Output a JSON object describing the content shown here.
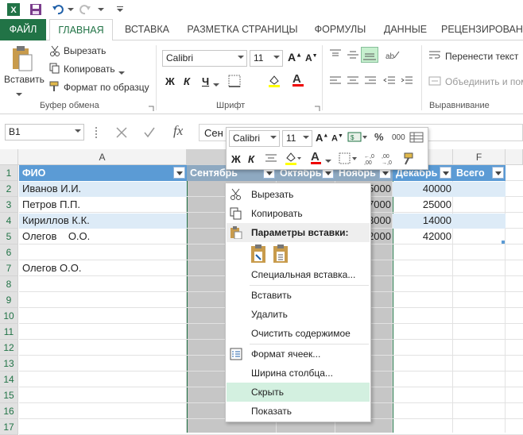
{
  "qat": {
    "icons": [
      "excel-icon",
      "save-icon",
      "undo-icon",
      "redo-icon",
      "customize-icon"
    ]
  },
  "tabs": [
    "ФАЙЛ",
    "ГЛАВНАЯ",
    "ВСТАВКА",
    "РАЗМЕТКА СТРАНИЦЫ",
    "ФОРМУЛЫ",
    "ДАННЫЕ",
    "РЕЦЕНЗИРОВАНИ"
  ],
  "clipboard": {
    "paste": "Вставить",
    "cut": "Вырезать",
    "copy": "Копировать",
    "format_painter": "Формат по образцу",
    "group": "Буфер обмена"
  },
  "font": {
    "name": "Calibri",
    "size": "11",
    "bold": "Ж",
    "italic": "К",
    "underline": "Ч",
    "group": "Шрифт"
  },
  "alignment": {
    "wrap": "Перенести текст",
    "merge": "Объединить и пом",
    "group": "Выравнивание"
  },
  "formula_bar": {
    "name_box": "B1",
    "fx": "fx",
    "value": "Сен"
  },
  "columns": [
    "A",
    "",
    "",
    "",
    "",
    "F"
  ],
  "rows": [
    "1",
    "2",
    "3",
    "4",
    "5",
    "6",
    "7",
    "8",
    "9",
    "10",
    "11",
    "12",
    "13",
    "14",
    "15",
    "16",
    "17"
  ],
  "table": {
    "headers": [
      "ФИО",
      "Сентябрь",
      "Октябрь",
      "Ноябрь",
      "Декабрь",
      "Всего"
    ],
    "rows": [
      {
        "name": "Иванов И.И.",
        "nov": "5000",
        "dec": "40000"
      },
      {
        "name": "Петров П.П.",
        "nov": "7000",
        "dec": "25000"
      },
      {
        "name": "Кириллов К.К.",
        "nov": "3000",
        "dec": "14000"
      },
      {
        "name": "Олегов    О.О.",
        "nov": "2000",
        "dec": "42000"
      }
    ],
    "a7": "Олегов О.О."
  },
  "minitoolbar": {
    "font": "Calibri",
    "size": "11",
    "percent": "%",
    "thousands": "000",
    "bold": "Ж",
    "italic": "К"
  },
  "context_menu": {
    "cut": "Вырезать",
    "copy": "Копировать",
    "paste_options": "Параметры вставки:",
    "paste_special": "Специальная вставка...",
    "insert": "Вставить",
    "delete": "Удалить",
    "clear": "Очистить содержимое",
    "format_cells": "Формат ячеек...",
    "col_width": "Ширина столбца...",
    "hide": "Скрыть",
    "show": "Показать"
  },
  "colors": {
    "excel_green": "#217346",
    "table_header": "#5b9bd5",
    "band": "#ddebf7",
    "selection": "#c6c6c6",
    "menu_hover": "#d3f0e0"
  }
}
